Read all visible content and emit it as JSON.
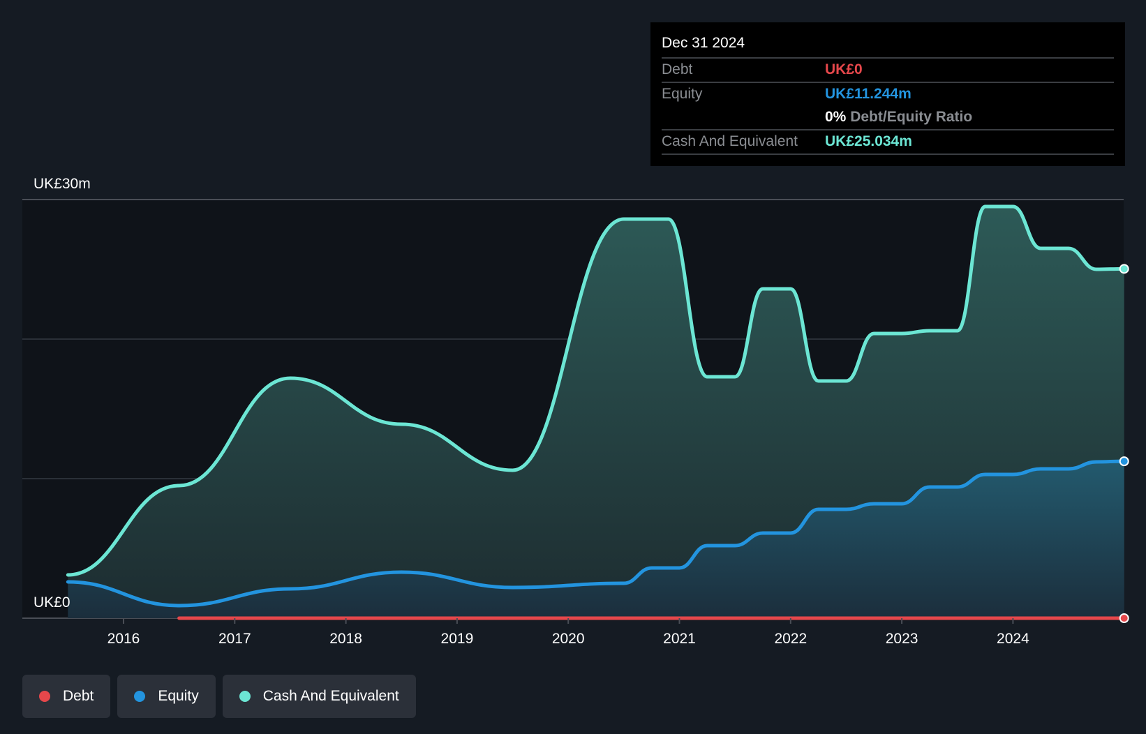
{
  "tooltip": {
    "date": "Dec 31 2024",
    "rows": [
      {
        "label": "Debt",
        "value": "UK£0",
        "color": "#e5474b"
      },
      {
        "label": "Equity",
        "value": "UK£11.244m",
        "color": "#2394df"
      },
      {
        "label": "",
        "value": "0%",
        "suffix": "Debt/Equity Ratio",
        "color": "#ffffff"
      },
      {
        "label": "Cash And Equivalent",
        "value": "UK£25.034m",
        "color": "#6ce6d4"
      }
    ]
  },
  "legend": [
    {
      "label": "Debt",
      "color": "#e5474b"
    },
    {
      "label": "Equity",
      "color": "#2394df"
    },
    {
      "label": "Cash And Equivalent",
      "color": "#6ce6d4"
    }
  ],
  "chart_data": {
    "type": "area",
    "title": "",
    "xlabel": "",
    "ylabel": "",
    "ylim": [
      0,
      30
    ],
    "xlim": [
      2015.0,
      2025.0
    ],
    "y_tick_labels": [
      {
        "value": 30,
        "label": "UK£30m"
      },
      {
        "value": 0,
        "label": "UK£0"
      }
    ],
    "gridlines": [
      0,
      10,
      20,
      30
    ],
    "x_ticks": [
      2016,
      2017,
      2018,
      2019,
      2020,
      2021,
      2022,
      2023,
      2024
    ],
    "legend_position": "bottom-left",
    "series": [
      {
        "name": "Cash And Equivalent",
        "color": "#6ce6d4",
        "x": [
          2015.5,
          2016.5,
          2017.5,
          2018.5,
          2019.5,
          2020.5,
          2020.9,
          2021.25,
          2021.5,
          2021.75,
          2022.0,
          2022.25,
          2022.5,
          2022.75,
          2023.0,
          2023.25,
          2023.5,
          2023.75,
          2024.0,
          2024.25,
          2024.5,
          2024.75,
          2025.0
        ],
        "values": [
          3.1,
          9.5,
          17.2,
          13.9,
          10.6,
          28.6,
          28.6,
          17.3,
          17.3,
          23.6,
          23.6,
          17.0,
          17.0,
          20.4,
          20.4,
          20.6,
          20.6,
          29.5,
          29.5,
          26.5,
          26.5,
          25.0,
          25.034
        ]
      },
      {
        "name": "Equity",
        "color": "#2394df",
        "x": [
          2015.5,
          2016.5,
          2017.5,
          2018.5,
          2019.5,
          2020.5,
          2020.75,
          2021.0,
          2021.25,
          2021.5,
          2021.75,
          2022.0,
          2022.25,
          2022.5,
          2022.75,
          2023.0,
          2023.25,
          2023.5,
          2023.75,
          2024.0,
          2024.25,
          2024.5,
          2024.75,
          2025.0
        ],
        "values": [
          2.6,
          0.9,
          2.1,
          3.3,
          2.2,
          2.5,
          3.6,
          3.6,
          5.2,
          5.2,
          6.1,
          6.1,
          7.8,
          7.8,
          8.2,
          8.2,
          9.4,
          9.4,
          10.3,
          10.3,
          10.7,
          10.7,
          11.2,
          11.244
        ]
      },
      {
        "name": "Debt",
        "color": "#e5474b",
        "x": [
          2016.5,
          2025.0
        ],
        "values": [
          0,
          0
        ]
      }
    ]
  }
}
